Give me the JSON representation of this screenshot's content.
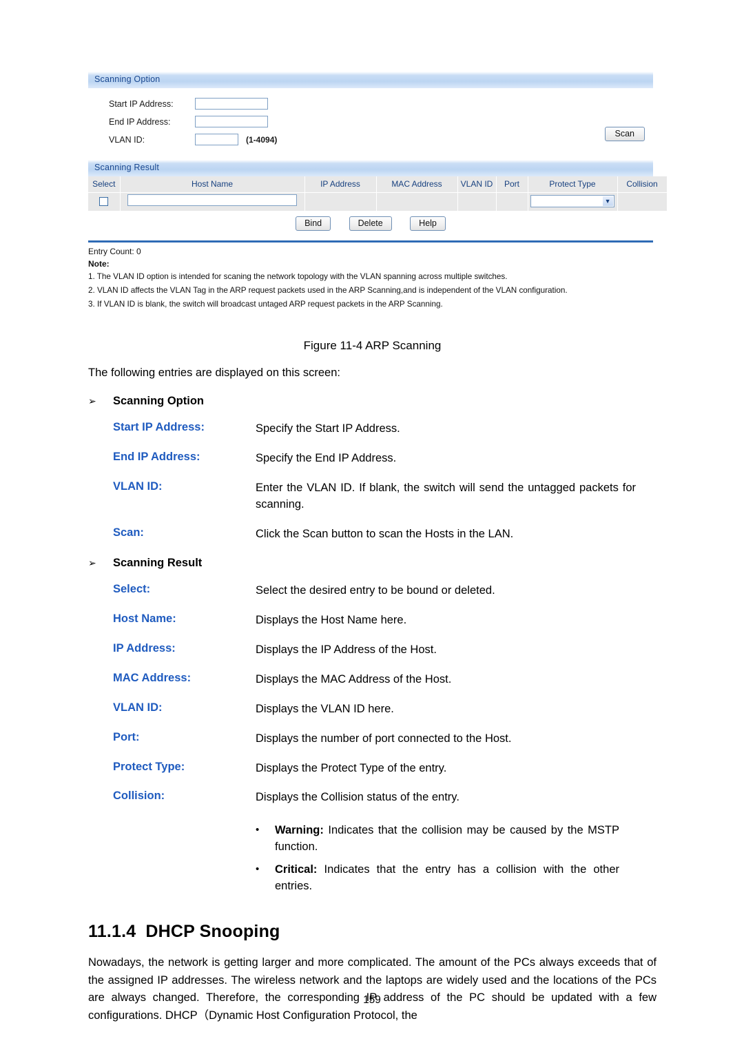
{
  "screenshot": {
    "scanning_option": {
      "panel_title": "Scanning Option",
      "fields": [
        {
          "label": "Start IP Address:",
          "value": "",
          "hint": ""
        },
        {
          "label": "End IP Address:",
          "value": "",
          "hint": ""
        },
        {
          "label": "VLAN ID:",
          "value": "",
          "hint": "(1-4094)"
        }
      ],
      "scan_button": "Scan"
    },
    "scanning_result": {
      "panel_title": "Scanning Result",
      "columns": [
        "Select",
        "Host Name",
        "IP Address",
        "MAC Address",
        "VLAN ID",
        "Port",
        "Protect Type",
        "Collision"
      ],
      "row": {
        "select_checked": false,
        "host_name": "",
        "ip_address": "",
        "mac_address": "",
        "vlan_id": "",
        "port": "",
        "protect_type": "",
        "collision": ""
      },
      "buttons": [
        "Bind",
        "Delete",
        "Help"
      ]
    },
    "entry_count": "Entry Count: 0",
    "note_label": "Note:",
    "notes": [
      "1. The VLAN ID option is intended for scaning the network topology with the VLAN spanning across multiple switches.",
      "2. VLAN ID affects the VLAN Tag in the ARP request packets used in the ARP Scanning,and is independent of the VLAN configuration.",
      "3. If VLAN ID is blank, the switch will broadcast untaged ARP request packets in the ARP Scanning."
    ],
    "colors": {
      "panel_header_text": "#19478f",
      "panel_header_bg": "#bcd5f2",
      "table_header_bg": "#e8e8e8",
      "rule_blue": "#2f6bb5",
      "input_border": "#7fa0c4"
    }
  },
  "document": {
    "figure_caption": "Figure 11-4 ARP Scanning",
    "intro": "The following entries are displayed on this screen:",
    "arrow_glyph": "➢",
    "bullet_glyph": "•",
    "sections": [
      {
        "title": "Scanning Option",
        "entries": [
          {
            "term": "Start IP Address:",
            "desc": "Specify the Start IP Address."
          },
          {
            "term": "End IP Address:",
            "desc": "Specify the End IP Address."
          },
          {
            "term": "VLAN ID:",
            "desc": "Enter the VLAN ID. If blank, the switch will send the untagged packets for scanning."
          },
          {
            "term": "Scan:",
            "desc": "Click the Scan button to scan the Hosts in the LAN."
          }
        ]
      },
      {
        "title": "Scanning Result",
        "entries": [
          {
            "term": "Select:",
            "desc": "Select the desired entry to be bound or deleted."
          },
          {
            "term": "Host Name:",
            "desc": "Displays the Host Name here."
          },
          {
            "term": "IP Address:",
            "desc": "Displays the IP Address of the Host."
          },
          {
            "term": "MAC Address:",
            "desc": "Displays the MAC Address of the Host."
          },
          {
            "term": "VLAN ID:",
            "desc": "Displays the VLAN ID here."
          },
          {
            "term": "Port:",
            "desc": "Displays the number of port connected to the Host."
          },
          {
            "term": "Protect Type:",
            "desc": "Displays the Protect Type of the entry."
          },
          {
            "term": "Collision:",
            "desc": "Displays the Collision status of the entry."
          }
        ]
      }
    ],
    "collision_bullets": [
      {
        "lead": "Warning:",
        "text": " Indicates that the collision may be caused by the MSTP function."
      },
      {
        "lead": "Critical:",
        "text": " Indicates that the entry has a collision with the other entries."
      }
    ],
    "heading": {
      "number": "11.1.4",
      "title": "DHCP Snooping"
    },
    "body_paragraph": "Nowadays, the network is getting larger and more complicated. The amount of the PCs always exceeds that of the assigned IP addresses. The wireless network and the laptops are widely used and the locations of the PCs are always changed. Therefore, the corresponding IP address of the PC should be updated with a few configurations. DHCP（Dynamic Host Configuration Protocol, the",
    "page_number": "159",
    "term_color": "#1f5bbf"
  }
}
